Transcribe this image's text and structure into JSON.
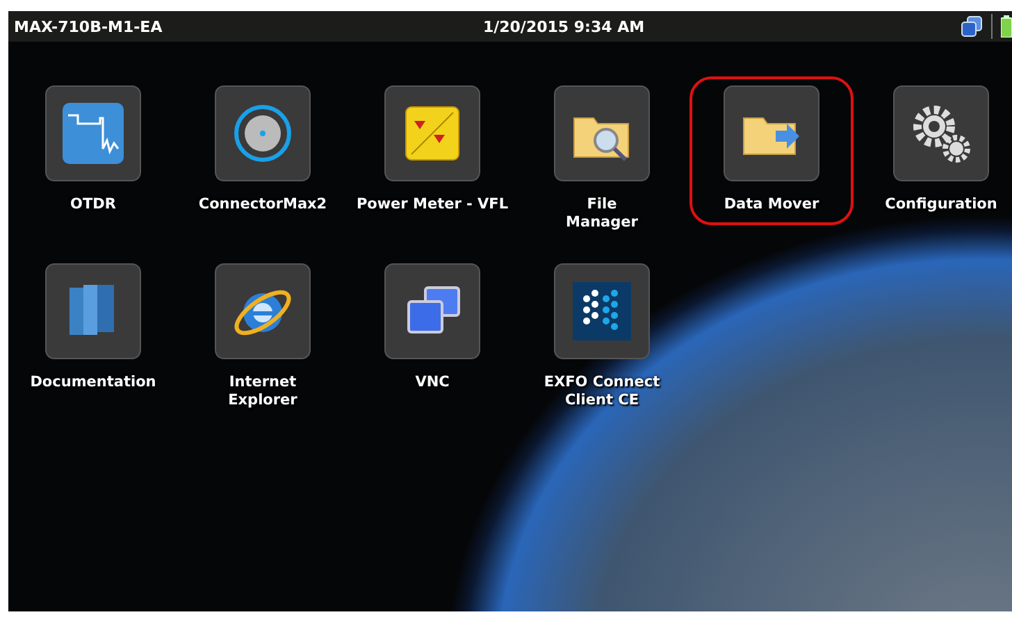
{
  "status_bar": {
    "device": "MAX-710B-M1-EA",
    "datetime": "1/20/2015 9:34 AM"
  },
  "apps": [
    {
      "label": "OTDR",
      "kind": "otdr",
      "selected": false
    },
    {
      "label": "ConnectorMax2",
      "kind": "connector",
      "selected": false
    },
    {
      "label": "Power Meter - VFL",
      "kind": "power",
      "selected": false
    },
    {
      "label": "File\nManager",
      "kind": "file",
      "selected": false
    },
    {
      "label": "Data Mover",
      "kind": "mover",
      "selected": true
    },
    {
      "label": "Configuration",
      "kind": "config",
      "selected": false
    },
    {
      "label": "Documentation",
      "kind": "docs",
      "selected": false
    },
    {
      "label": "Internet\nExplorer",
      "kind": "ie",
      "selected": false
    },
    {
      "label": "VNC",
      "kind": "vnc",
      "selected": false
    },
    {
      "label": "EXFO Connect\nClient CE",
      "kind": "exfo",
      "selected": false
    }
  ]
}
